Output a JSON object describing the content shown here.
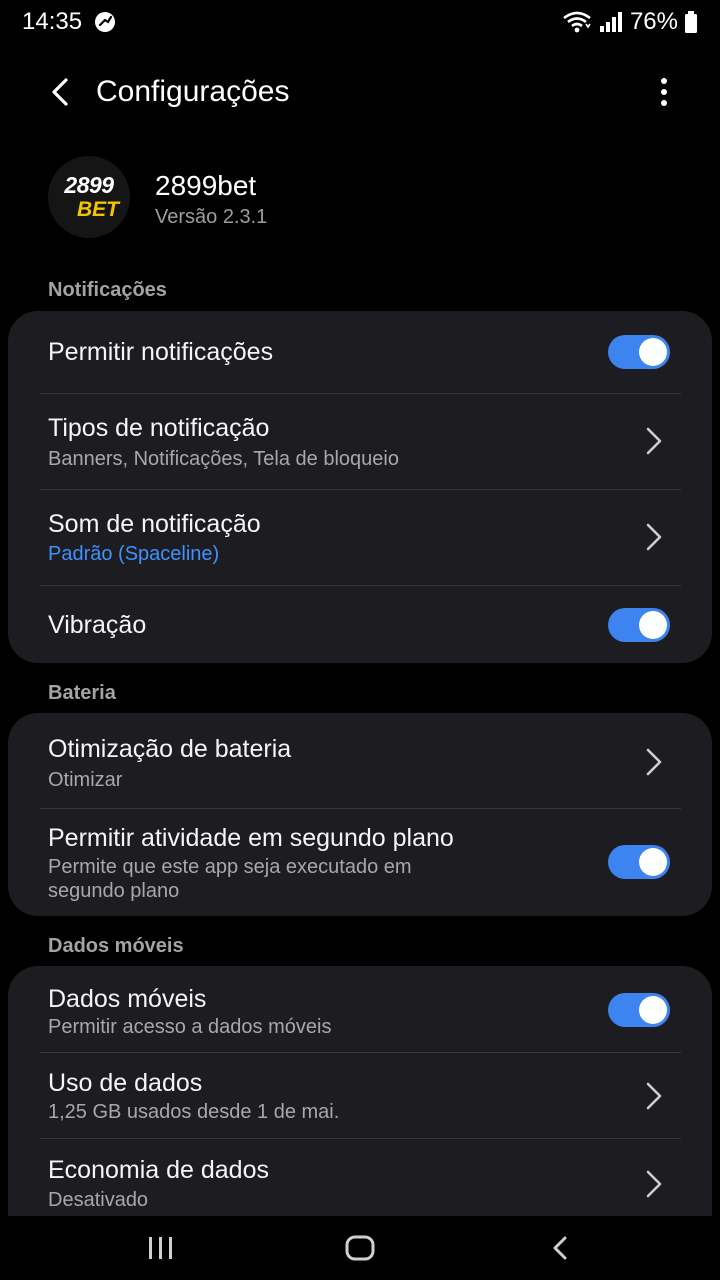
{
  "status_bar": {
    "time": "14:35",
    "battery": "76%",
    "icons": [
      "no-disturb-icon",
      "wifi-icon",
      "signal-icon",
      "battery-icon"
    ]
  },
  "app_bar": {
    "title": "Configurações",
    "back_icon": "back-arrow-icon",
    "more_icon": "more-vert-icon"
  },
  "app_info": {
    "logo_top": "2899",
    "logo_bottom": "BET",
    "name": "2899bet",
    "version": "Versão 2.3.1"
  },
  "sections": {
    "notifications": {
      "header": "Notificações",
      "items": [
        {
          "title": "Permitir notificações",
          "control": "toggle",
          "on": true
        },
        {
          "title": "Tipos de notificação",
          "subtitle": "Banners, Notificações, Tela de bloqueio",
          "control": "chevron"
        },
        {
          "title": "Som de notificação",
          "subtitle": "Padrão (Spaceline)",
          "control": "chevron"
        },
        {
          "title": "Vibração",
          "control": "toggle",
          "on": true
        }
      ]
    },
    "battery": {
      "header": "Bateria",
      "items": [
        {
          "title": "Otimização de bateria",
          "subtitle": "Otimizar",
          "control": "chevron"
        },
        {
          "title": "Permitir atividade em segundo plano",
          "subtitle": "Permite que este app seja executado em segundo plano",
          "control": "toggle",
          "on": true
        }
      ]
    },
    "mobile_data": {
      "header": "Dados móveis",
      "items": [
        {
          "title": "Dados móveis",
          "subtitle": "Permitir acesso a dados móveis",
          "control": "toggle",
          "on": true
        },
        {
          "title": "Uso de dados",
          "subtitle": "1,25 GB usados desde 1 de mai.",
          "control": "chevron"
        },
        {
          "title": "Economia de dados",
          "subtitle": "Desativado",
          "control": "chevron"
        }
      ]
    }
  },
  "colors": {
    "background": "#000000",
    "card": "#1d1d21",
    "accent": "#3e84f0",
    "link": "#3e91ff",
    "logo_yellow": "#f5c400"
  },
  "nav_bar": {
    "icons": [
      "recents-icon",
      "home-icon",
      "back-icon"
    ]
  }
}
